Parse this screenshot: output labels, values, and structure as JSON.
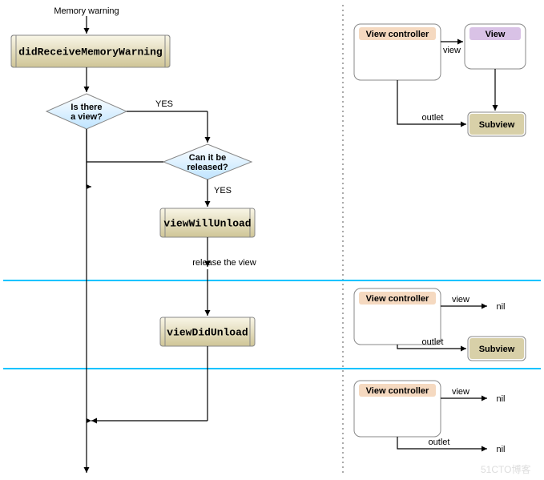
{
  "flow": {
    "start_label": "Memory warning",
    "step1": "didReceiveMemoryWarning",
    "decision1_line1": "Is there",
    "decision1_line2": "a view?",
    "decision1_yes": "YES",
    "decision2_line1": "Can it be",
    "decision2_line2": "released?",
    "decision2_yes": "YES",
    "step2": "viewWillUnload",
    "release_label": "release the view",
    "step3": "viewDidUnload"
  },
  "panel1": {
    "vc": "View controller",
    "view": "View",
    "subview": "Subview",
    "edge_view": "view",
    "edge_outlet": "outlet"
  },
  "panel2": {
    "vc": "View controller",
    "subview": "Subview",
    "edge_view": "view",
    "edge_outlet": "outlet",
    "nil": "nil"
  },
  "panel3": {
    "vc": "View controller",
    "edge_view": "view",
    "edge_outlet": "outlet",
    "nil1": "nil",
    "nil2": "nil"
  },
  "watermark": "51CTO博客"
}
